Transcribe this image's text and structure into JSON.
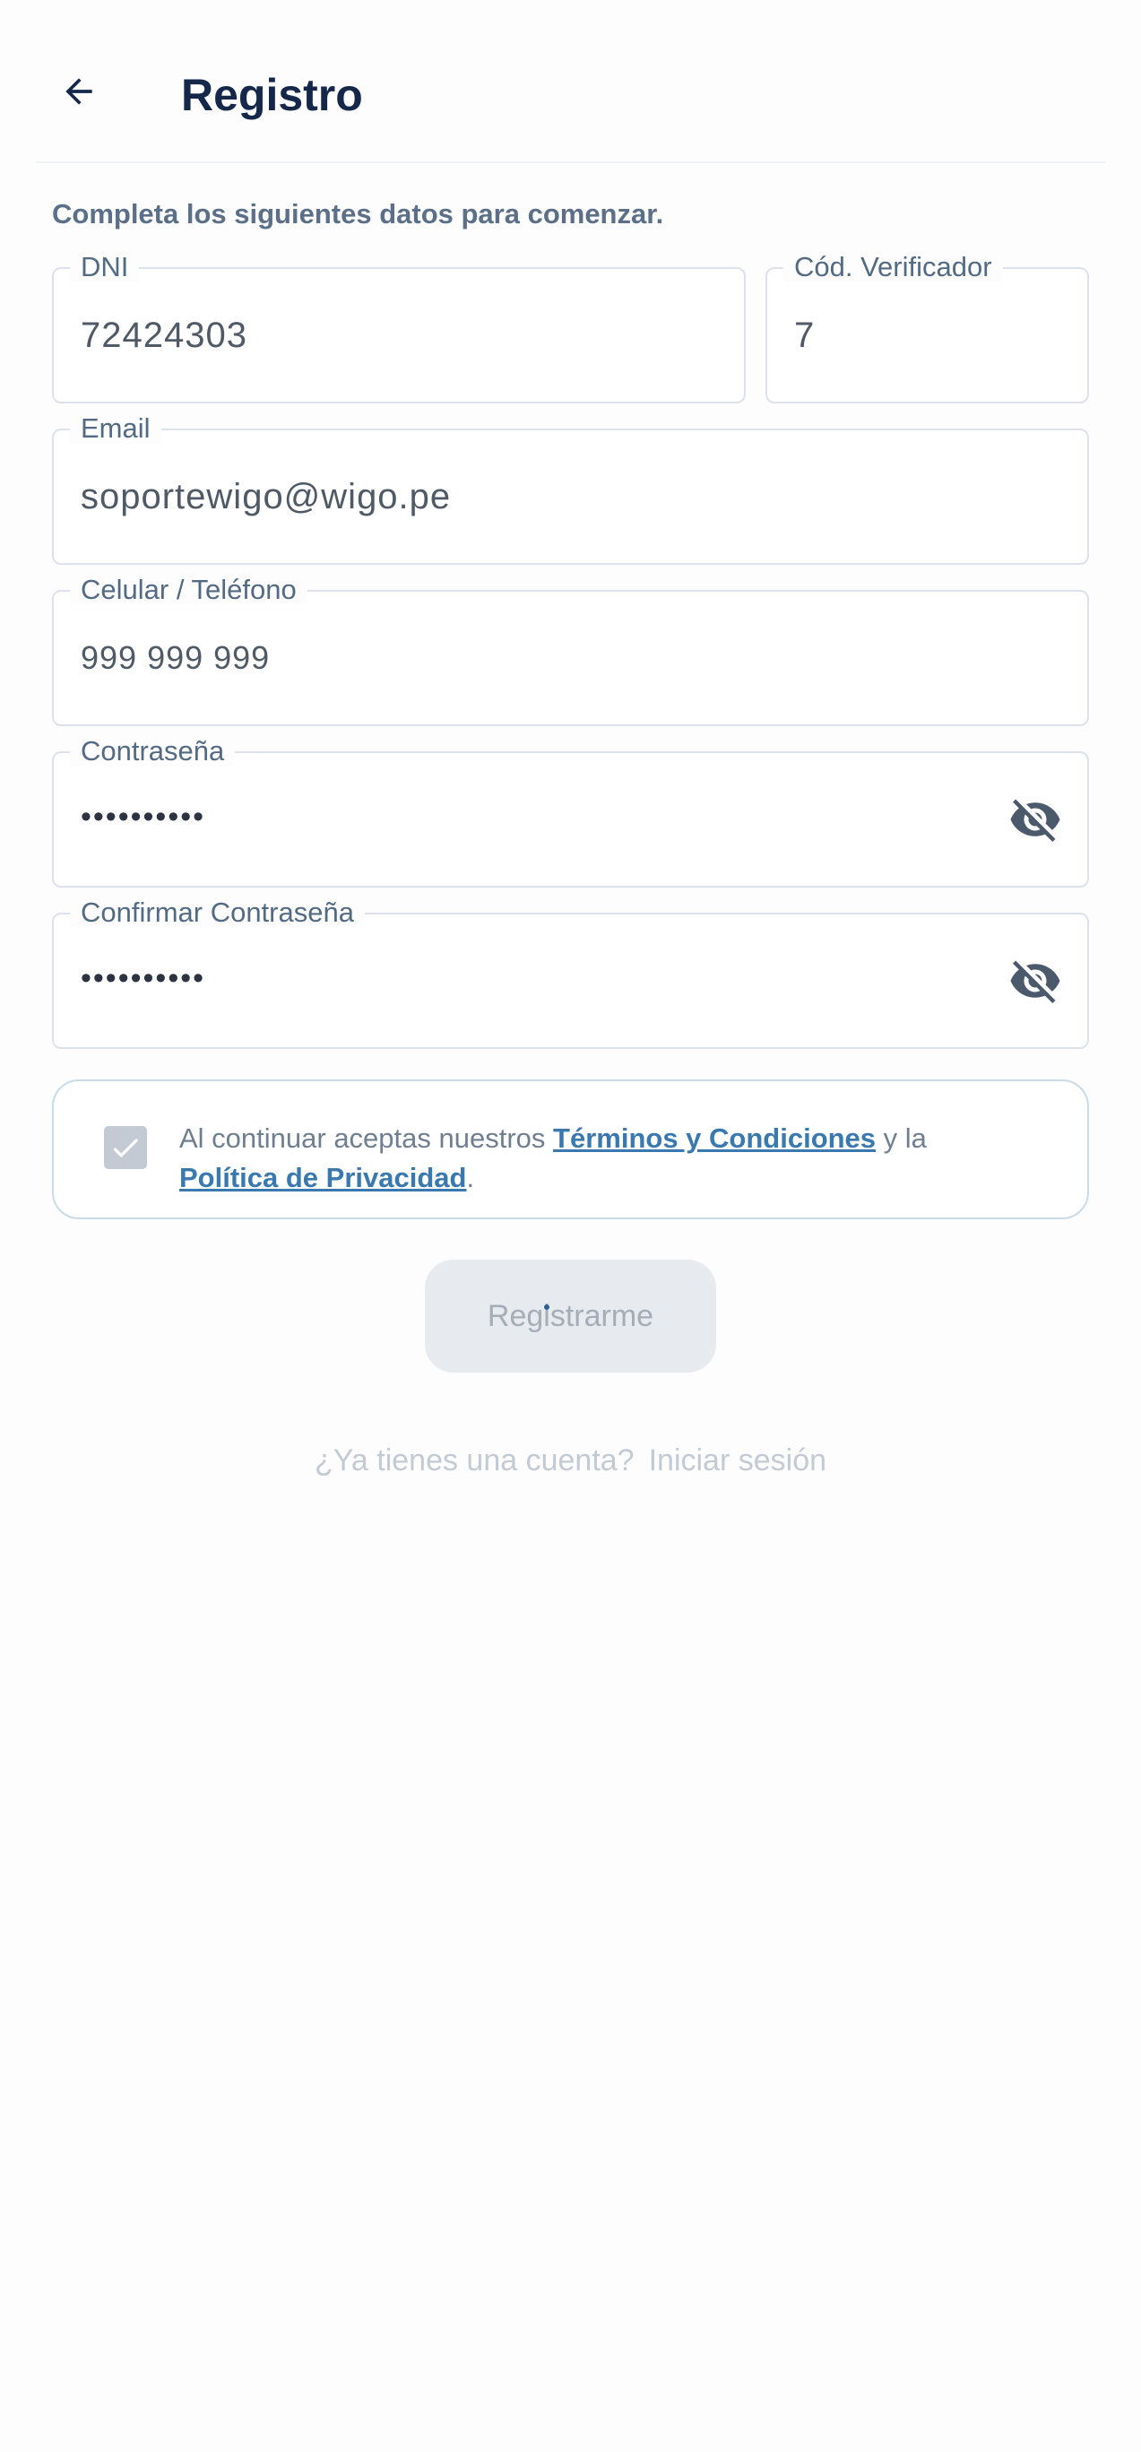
{
  "header": {
    "title": "Registro",
    "back_icon": "arrow-left-icon"
  },
  "subtitle": "Completa los siguientes datos para comenzar.",
  "form": {
    "dni": {
      "label": "DNI",
      "value": "72424303"
    },
    "cod_verificador": {
      "label": "Cód. Verificador",
      "value": "7"
    },
    "email": {
      "label": "Email",
      "value": "soportewigo@wigo.pe"
    },
    "celular": {
      "label": "Celular / Teléfono",
      "placeholder": "999 999 999"
    },
    "password": {
      "label": "Contraseña",
      "value": "••••••••••",
      "toggle_icon": "eye-off-icon"
    },
    "confirm_password": {
      "label": "Confirmar Contraseña",
      "value": "••••••••••",
      "toggle_icon": "eye-off-icon"
    }
  },
  "terms": {
    "checked": true,
    "prefix": "Al continuar aceptas nuestros ",
    "terms_link": "Términos y Condiciones",
    "middle": " y la ",
    "privacy_link": "Política de Privacidad",
    "suffix": "."
  },
  "register_button": {
    "label": "Registrarme"
  },
  "login": {
    "question": "¿Ya tienes una cuenta?",
    "link": "Iniciar sesión"
  },
  "colors": {
    "title": "#15284a",
    "link": "#3a79b0",
    "border": "#dde2ea",
    "button_disabled_bg": "#e7eaee"
  }
}
